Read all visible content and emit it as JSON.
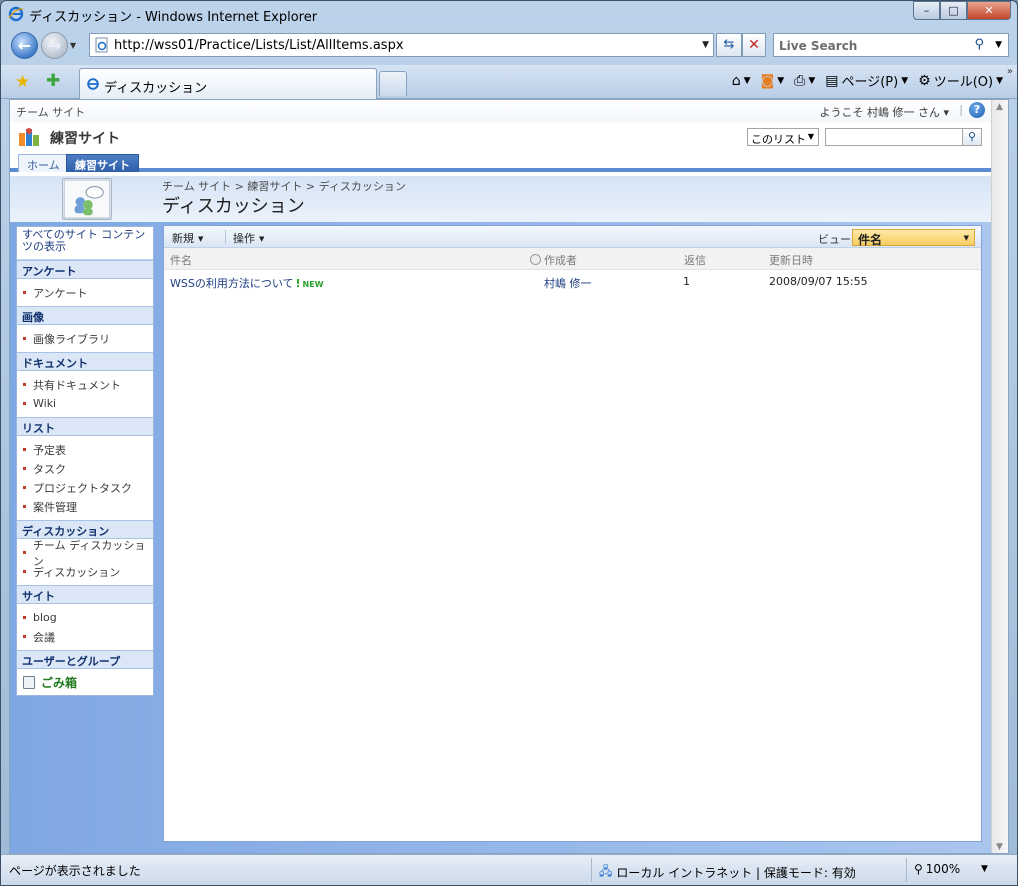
{
  "window": {
    "title": "ディスカッション - Windows Internet Explorer",
    "min_glyph": "–",
    "max_glyph": "□",
    "close_glyph": "✕"
  },
  "address": {
    "url": "http://wss01/Practice/Lists/List/AllItems.aspx",
    "search_placeholder": "Live Search"
  },
  "tabs": {
    "active_label": "ディスカッション"
  },
  "commands": {
    "page_label": "ページ(P)",
    "tools_label": "ツール(O)",
    "more_glyph": "»"
  },
  "sharepoint": {
    "global_site_link": "チーム サイト",
    "welcome": "ようこそ 村嶋 修一 さん ▾",
    "sep": "|",
    "help_glyph": "?",
    "site_name": "練習サイト",
    "search_scope": "このリスト",
    "topnav": {
      "home": "ホーム",
      "current": "練習サイト"
    },
    "breadcrumb": "チーム サイト > 練習サイト > ディスカッション",
    "page_title": "ディスカッション"
  },
  "quicklaunch": {
    "view_all": "すべてのサイト コンテンツの表示",
    "sections": [
      {
        "heading": "アンケート",
        "items": [
          "アンケート"
        ]
      },
      {
        "heading": "画像",
        "items": [
          "画像ライブラリ"
        ]
      },
      {
        "heading": "ドキュメント",
        "items": [
          "共有ドキュメント",
          "Wiki"
        ]
      },
      {
        "heading": "リスト",
        "items": [
          "予定表",
          "タスク",
          "プロジェクトタスク",
          "案件管理"
        ]
      },
      {
        "heading": "ディスカッション",
        "items": [
          "チーム ディスカッション",
          "ディスカッション"
        ]
      },
      {
        "heading": "サイト",
        "items": [
          "blog",
          "会議"
        ]
      },
      {
        "heading": "ユーザーとグループ",
        "items": []
      }
    ],
    "recycle_bin": "ごみ箱"
  },
  "list": {
    "toolbar": {
      "new_label": "新規",
      "actions_label": "操作",
      "view_label": "ビュー:",
      "view_value": "件名"
    },
    "columns": {
      "subject": "件名",
      "author": "作成者",
      "replies": "返信",
      "updated": "更新日時"
    },
    "rows": [
      {
        "subject": "WSSの利用方法について",
        "new_badge": "NEW",
        "author": "村嶋 修一",
        "replies": "1",
        "updated": "2008/09/07 15:55"
      }
    ]
  },
  "status": {
    "message": "ページが表示されました",
    "zone": "ローカル イントラネット | 保護モード: 有効",
    "zoom": "100%"
  },
  "icons": {
    "ie_logo": "ie-logo-icon",
    "back": "back-arrow-icon",
    "forward": "forward-arrow-icon",
    "refresh": "refresh-icon",
    "stop": "stop-icon",
    "search": "search-icon",
    "favorites": "star-icon",
    "add_favorite": "add-favorite-icon",
    "home": "home-icon",
    "feeds": "feed-icon",
    "print": "print-icon",
    "page": "page-icon",
    "tools": "gear-icon",
    "help": "help-icon",
    "recycle": "recycle-bin-icon",
    "zone": "intranet-icon",
    "zoom": "zoom-icon"
  }
}
